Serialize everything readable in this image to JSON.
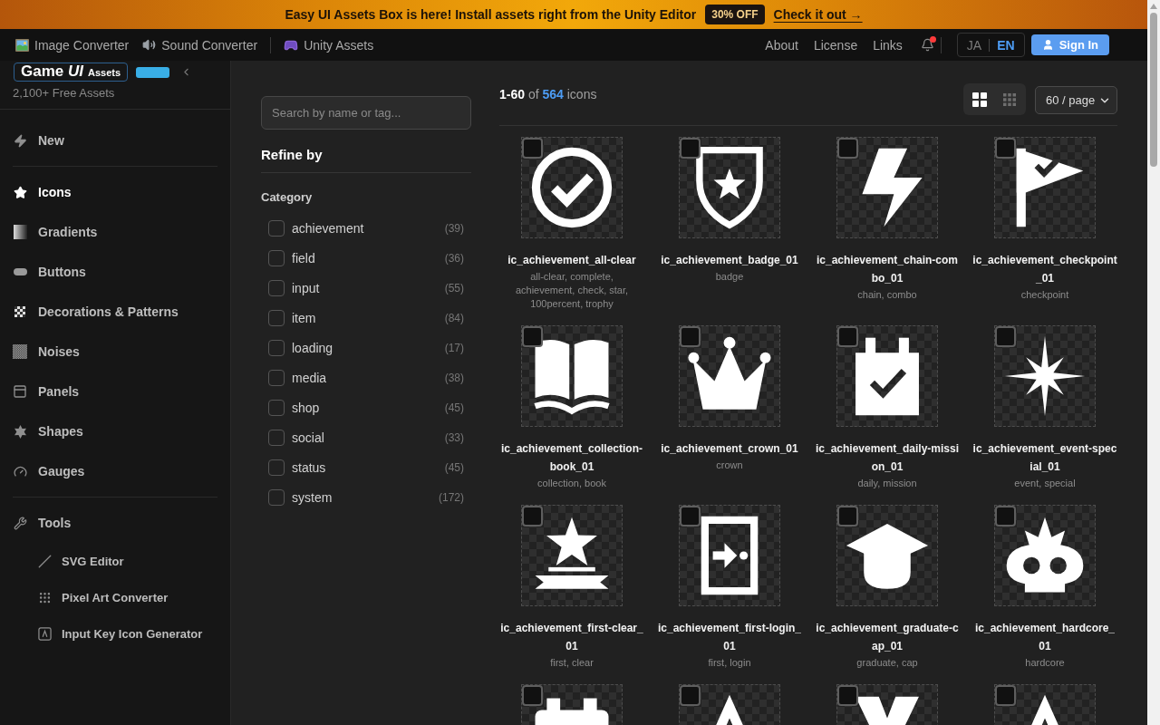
{
  "banner": {
    "text": "Easy UI Assets Box is here! Install assets right from the Unity Editor",
    "badge": "30% OFF",
    "link": "Check it out →"
  },
  "nav": {
    "groups": [
      {
        "items": [
          {
            "label": "Image Converter"
          },
          {
            "label": "Sound Converter"
          }
        ]
      },
      {
        "items": [
          {
            "label": "Unity Assets"
          }
        ]
      }
    ],
    "links": [
      {
        "label": "About"
      },
      {
        "label": "License"
      },
      {
        "label": "Links"
      }
    ],
    "unread": true,
    "languages": [
      {
        "label": "JA",
        "selected": false
      },
      {
        "label": "EN",
        "selected": true
      }
    ],
    "sign_in": "Sign In"
  },
  "sidebar": {
    "logo": {
      "title": "Game *UI*",
      "subtitle": "Assets"
    },
    "tagline": "2,100+ Free Assets",
    "sections": [
      {
        "items": [
          {
            "label": "New",
            "selected": false
          }
        ]
      },
      {
        "items": [
          {
            "label": "Icons",
            "selected": true
          },
          {
            "label": "Gradients",
            "selected": false
          },
          {
            "label": "Buttons",
            "selected": false
          },
          {
            "label": "Decorations & Patterns",
            "selected": false
          },
          {
            "label": "Noises",
            "selected": false
          },
          {
            "label": "Panels",
            "selected": false
          },
          {
            "label": "Shapes",
            "selected": false
          },
          {
            "label": "Gauges",
            "selected": false
          }
        ]
      },
      {
        "items": [
          {
            "label": "Tools",
            "selected": false,
            "children": [
              {
                "label": "SVG Editor",
                "selected": false
              },
              {
                "label": "Pixel Art Converter",
                "selected": false
              },
              {
                "label": "Input Key Icon Generator",
                "selected": false
              }
            ]
          }
        ]
      }
    ]
  },
  "filters": {
    "search": {
      "placeholder": "Search by name or tag..."
    },
    "title": "Refine by",
    "category": {
      "title": "Category",
      "options": [
        {
          "label": "achievement",
          "count": "(39)",
          "checked": false
        },
        {
          "label": "field",
          "count": "(36)",
          "checked": false
        },
        {
          "label": "input",
          "count": "(55)",
          "checked": false
        },
        {
          "label": "item",
          "count": "(84)",
          "checked": false
        },
        {
          "label": "loading",
          "count": "(17)",
          "checked": false
        },
        {
          "label": "media",
          "count": "(38)",
          "checked": false
        },
        {
          "label": "shop",
          "count": "(45)",
          "checked": false
        },
        {
          "label": "social",
          "count": "(33)",
          "checked": false
        },
        {
          "label": "status",
          "count": "(45)",
          "checked": false
        },
        {
          "label": "system",
          "count": "(172)",
          "checked": false
        }
      ]
    }
  },
  "results": {
    "summary": "**1-60** of **564** icons",
    "view_modes": [
      {
        "selected": true
      },
      {
        "selected": false
      }
    ],
    "page_size": "60 / page",
    "items": [
      {
        "name": "ic_achievement_all-clear",
        "tags": "all-clear, complete, achievement, check, star, 100percent, trophy",
        "checked": false
      },
      {
        "name": "ic_achievement_badge_01",
        "tags": "badge",
        "checked": false
      },
      {
        "name": "ic_achievement_chain-combo_01",
        "tags": "chain, combo",
        "checked": false
      },
      {
        "name": "ic_achievement_checkpoint_01",
        "tags": "checkpoint",
        "checked": false
      },
      {
        "name": "ic_achievement_collection-book_01",
        "tags": "collection, book",
        "checked": false
      },
      {
        "name": "ic_achievement_crown_01",
        "tags": "crown",
        "checked": false
      },
      {
        "name": "ic_achievement_daily-mission_01",
        "tags": "daily, mission",
        "checked": false
      },
      {
        "name": "ic_achievement_event-special_01",
        "tags": "event, special",
        "checked": false
      },
      {
        "name": "ic_achievement_first-clear_01",
        "tags": "first, clear",
        "checked": false
      },
      {
        "name": "ic_achievement_first-login_01",
        "tags": "first, login",
        "checked": false
      },
      {
        "name": "ic_achievement_graduate-cap_01",
        "tags": "graduate, cap",
        "checked": false
      },
      {
        "name": "ic_achievement_hardcore_01",
        "tags": "hardcore",
        "checked": false
      },
      {
        "checked": false
      },
      {
        "checked": false
      },
      {
        "checked": false
      },
      {
        "checked": false
      }
    ]
  }
}
